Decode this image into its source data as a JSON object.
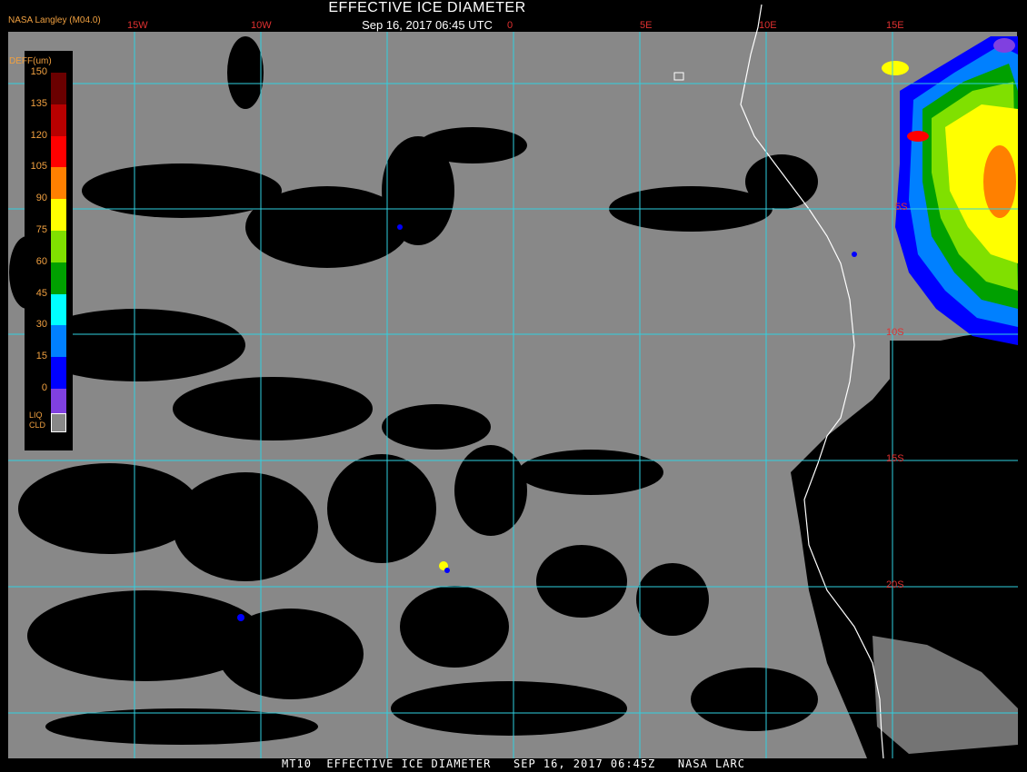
{
  "header": {
    "title": "EFFECTIVE ICE DIAMETER",
    "timestamp": "Sep 16, 2017 06:45 UTC",
    "credit": "NASA Langley (M04.0)"
  },
  "legend": {
    "title": "DEFF(um)",
    "ticks": [
      "150",
      "135",
      "120",
      "105",
      "90",
      "75",
      "60",
      "45",
      "30",
      "15",
      "0"
    ],
    "colors": [
      "#6a0000",
      "#b80000",
      "#ff0000",
      "#ff8000",
      "#ffff00",
      "#80e000",
      "#00a000",
      "#00ffff",
      "#0080ff",
      "#0000ff",
      "#8040e0"
    ],
    "liquid_label_line1": "LIQ",
    "liquid_label_line2": "CLD",
    "liquid_color": "#888888"
  },
  "grid": {
    "lon_labels": [
      "15W",
      "10W",
      "0",
      "5E",
      "10E",
      "15E"
    ],
    "lat_labels": [
      "5S",
      "10S",
      "15S",
      "20S"
    ],
    "line_color": "#30d0e0"
  },
  "colors": {
    "ocean": "#000000",
    "cloud_liquid": "#888888",
    "coast": "#ffffff"
  },
  "footer": {
    "text": "MT10  EFFECTIVE ICE DIAMETER   SEP 16, 2017 06:45Z   NASA LARC"
  }
}
